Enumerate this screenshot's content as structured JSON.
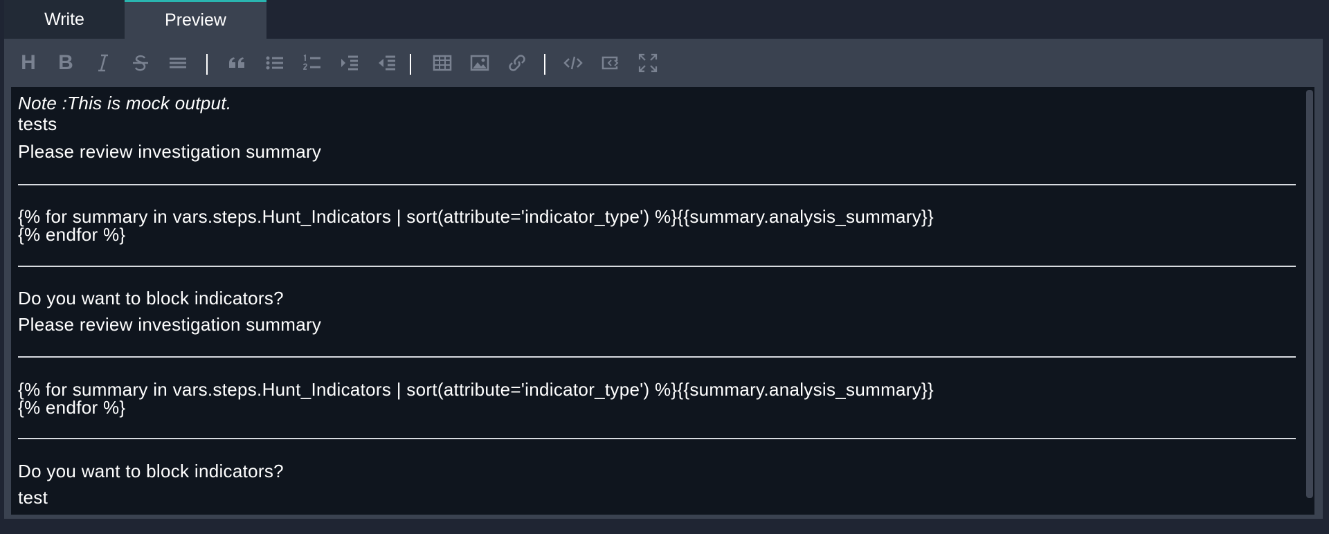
{
  "tabs": {
    "write_label": "Write",
    "preview_label": "Preview",
    "active": "Preview"
  },
  "toolbar": {
    "buttons": [
      {
        "name": "heading",
        "icon": "heading-icon",
        "glyph": "H"
      },
      {
        "name": "bold",
        "icon": "bold-icon",
        "glyph": "B"
      },
      {
        "name": "italic",
        "icon": "italic-icon"
      },
      {
        "name": "strikethrough",
        "icon": "strikethrough-icon"
      },
      {
        "name": "horizontal-rule",
        "icon": "horizontal-rule-icon"
      },
      {
        "name": "quote",
        "icon": "quote-icon"
      },
      {
        "name": "unordered-list",
        "icon": "unordered-list-icon"
      },
      {
        "name": "ordered-list",
        "icon": "ordered-list-icon"
      },
      {
        "name": "indent",
        "icon": "indent-icon"
      },
      {
        "name": "outdent",
        "icon": "outdent-icon"
      },
      {
        "name": "table",
        "icon": "table-icon"
      },
      {
        "name": "image",
        "icon": "image-icon"
      },
      {
        "name": "link",
        "icon": "link-icon"
      },
      {
        "name": "code",
        "icon": "code-icon"
      },
      {
        "name": "code-block",
        "icon": "code-block-icon"
      },
      {
        "name": "fullscreen",
        "icon": "fullscreen-icon"
      }
    ],
    "icon_color": "#7a8291"
  },
  "preview": {
    "note": "Note :This is mock output.",
    "line_tests": "tests",
    "review_1": "Please review investigation summary",
    "loop_1": "{% for summary in vars.steps.Hunt_Indicators | sort(attribute='indicator_type') %}{{summary.analysis_summary}}",
    "endfor_1": "{% endfor %}",
    "question_1": "Do you want to block indicators?",
    "review_2": "Please review investigation summary",
    "loop_2": "{% for summary in vars.steps.Hunt_Indicators | sort(attribute='indicator_type') %}{{summary.analysis_summary}}",
    "endfor_2": "{% endfor %}",
    "question_2": "Do you want to block indicators?",
    "line_test": "test"
  },
  "colors": {
    "accent": "#2ab5b0",
    "background": "#1f2533",
    "panel": "#3a4250",
    "preview_bg": "#0f151e"
  }
}
